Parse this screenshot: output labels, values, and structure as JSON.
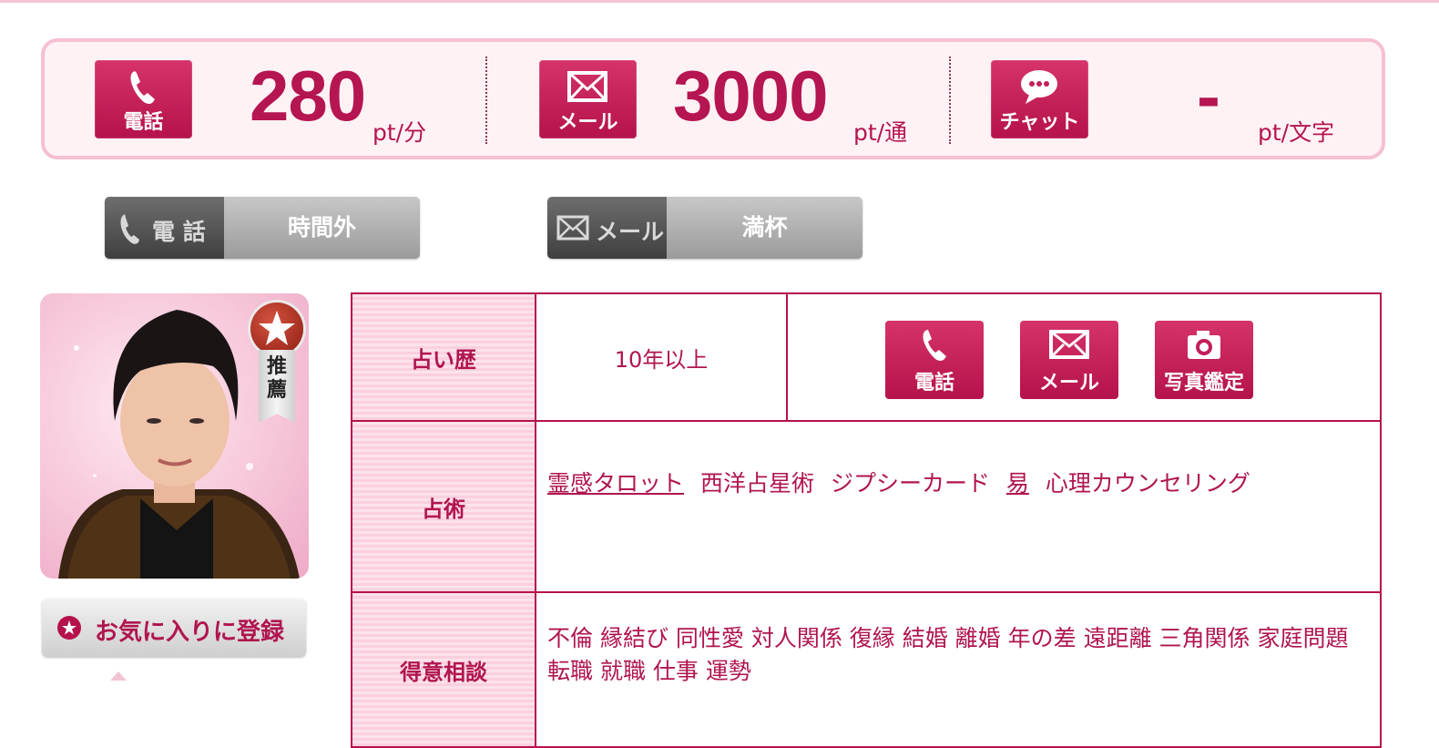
{
  "prices": {
    "phone": {
      "icon_label": "電話",
      "value": "280",
      "unit": "pt/分"
    },
    "mail": {
      "icon_label": "メール",
      "value": "3000",
      "unit": "pt/通"
    },
    "chat": {
      "icon_label": "チャット",
      "value": "-",
      "unit": "pt/文字"
    }
  },
  "status": {
    "phone": {
      "label": "電 話",
      "state": "時間外"
    },
    "mail": {
      "label": "メール",
      "state": "満杯"
    }
  },
  "profile": {
    "badge_text": [
      "推",
      "薦"
    ],
    "favorite_label": "お気に入りに登録"
  },
  "info": {
    "experience_header": "占い歴",
    "experience_value": "10年以上",
    "services": [
      "電話",
      "メール",
      "写真鑑定"
    ],
    "methods_header": "占術",
    "methods": [
      {
        "text": "霊感タロット",
        "link": true
      },
      {
        "text": "西洋占星術",
        "link": false
      },
      {
        "text": "ジプシーカード",
        "link": false
      },
      {
        "text": "易",
        "link": true
      },
      {
        "text": "心理カウンセリング",
        "link": false
      }
    ],
    "specialties_header": "得意相談",
    "specialties_text": "不倫 縁結び 同性愛 対人関係 復縁 結婚 離婚 年の差 遠距離 三角関係 家庭問題 転職 就職 仕事 運勢"
  },
  "colors": {
    "accent": "#b5124b",
    "accent_light": "#f6c0d2",
    "panel_bg": "#fff2f5",
    "gray_dark": "#4a4a4a",
    "gray_light": "#b0b0b0"
  },
  "icons": [
    "phone-icon",
    "mail-icon",
    "chat-icon",
    "camera-icon",
    "star-icon"
  ]
}
